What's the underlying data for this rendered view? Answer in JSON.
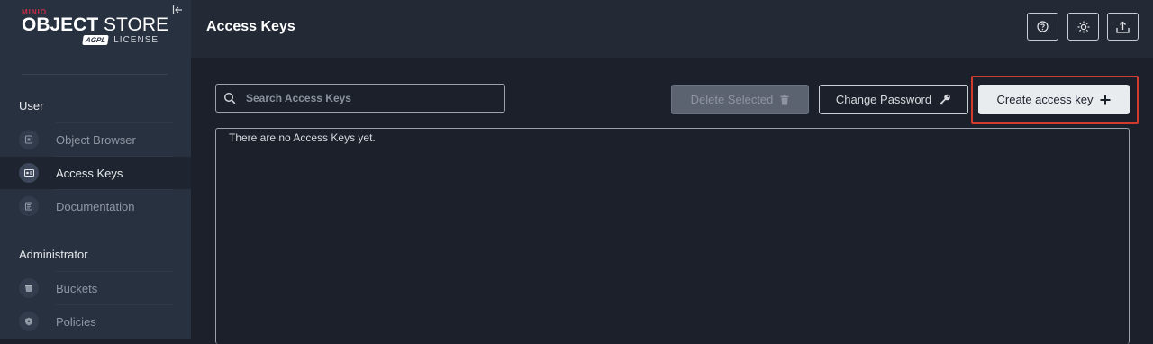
{
  "sidebar": {
    "logo": {
      "brand": "MINIO",
      "product_bold": "OBJECT",
      "product_light": "STORE",
      "badge": "AGPL",
      "license": "LICENSE"
    },
    "sections": [
      {
        "title": "User",
        "items": [
          {
            "label": "Object Browser",
            "icon": "object-browser-icon",
            "active": false
          },
          {
            "label": "Access Keys",
            "icon": "access-keys-icon",
            "active": true
          },
          {
            "label": "Documentation",
            "icon": "documentation-icon",
            "active": false
          }
        ]
      },
      {
        "title": "Administrator",
        "items": [
          {
            "label": "Buckets",
            "icon": "buckets-icon",
            "active": false
          },
          {
            "label": "Policies",
            "icon": "policies-icon",
            "active": false
          }
        ]
      }
    ]
  },
  "header": {
    "title": "Access Keys",
    "buttons": [
      {
        "icon": "help-icon"
      },
      {
        "icon": "theme-toggle-icon"
      },
      {
        "icon": "upload-icon"
      }
    ]
  },
  "main": {
    "search_placeholder": "Search Access Keys",
    "delete_label": "Delete Selected",
    "change_password_label": "Change Password",
    "create_label": "Create access key",
    "empty_message": "There are no Access Keys yet."
  },
  "colors": {
    "accent_highlight": "#d23a2d",
    "sidebar_bg": "#283140",
    "main_bg": "#1b202a"
  }
}
